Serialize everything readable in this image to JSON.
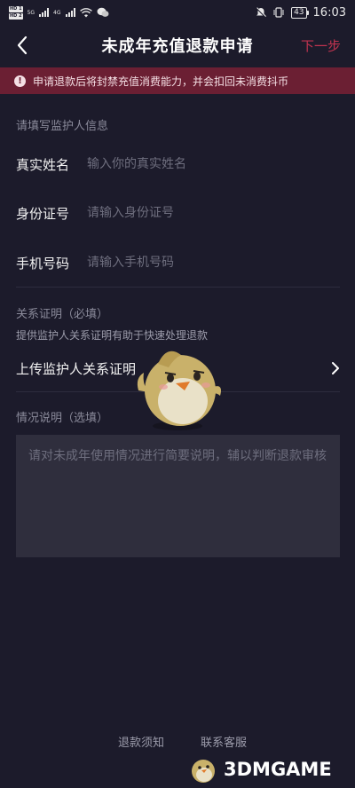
{
  "status_bar": {
    "sim1": "HD 1",
    "sim2": "HD 2",
    "net1": "5G",
    "net2": "4G",
    "battery": "43",
    "time": "16:03"
  },
  "nav": {
    "title": "未成年充值退款申请",
    "next_label": "下一步"
  },
  "warning": {
    "text": "申请退款后将封禁充值消费能力，并会扣回未消费抖币"
  },
  "guardian": {
    "section_label": "请填写监护人信息",
    "fields": [
      {
        "label": "真实姓名",
        "placeholder": "输入你的真实姓名"
      },
      {
        "label": "身份证号",
        "placeholder": "请输入身份证号"
      },
      {
        "label": "手机号码",
        "placeholder": "请输入手机号码"
      }
    ]
  },
  "relation": {
    "section_label": "关系证明（必填）",
    "hint": "提供监护人关系证明有助于快速处理退款",
    "upload_label": "上传监护人关系证明"
  },
  "situation": {
    "section_label": "情况说明（选填）",
    "placeholder": "请对未成年使用情况进行简要说明，辅以判断退款审核"
  },
  "footer": {
    "refund_notice": "退款须知",
    "contact": "联系客服"
  },
  "watermark": {
    "text": "3DMGAME"
  },
  "colors": {
    "background": "#1c1b2b",
    "accent": "#c0334f",
    "warning_bg": "#6b1f33"
  }
}
